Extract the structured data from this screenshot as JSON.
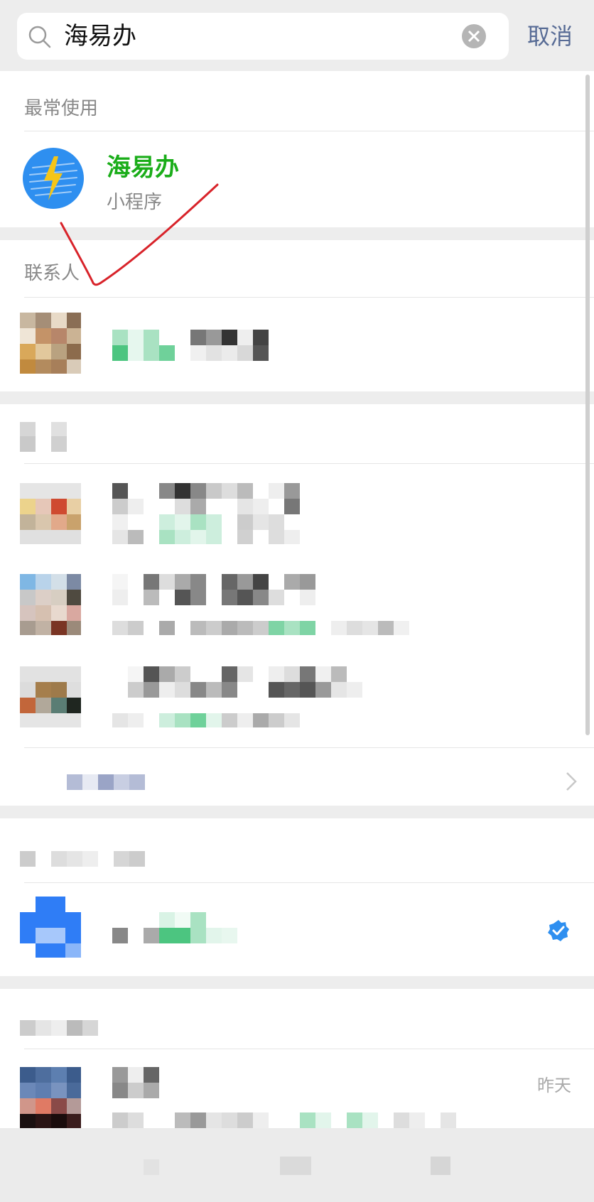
{
  "search": {
    "query": "海易办",
    "cancel_label": "取消"
  },
  "frequent": {
    "header": "最常使用",
    "item": {
      "name": "海易办",
      "type": "小程序"
    }
  },
  "contacts": {
    "header": "联系人"
  },
  "official": {
    "time": "昨天"
  },
  "colors": {
    "accent_green": "#1aad19",
    "link_blue": "#576b95",
    "verified_blue": "#2e8ff0"
  }
}
